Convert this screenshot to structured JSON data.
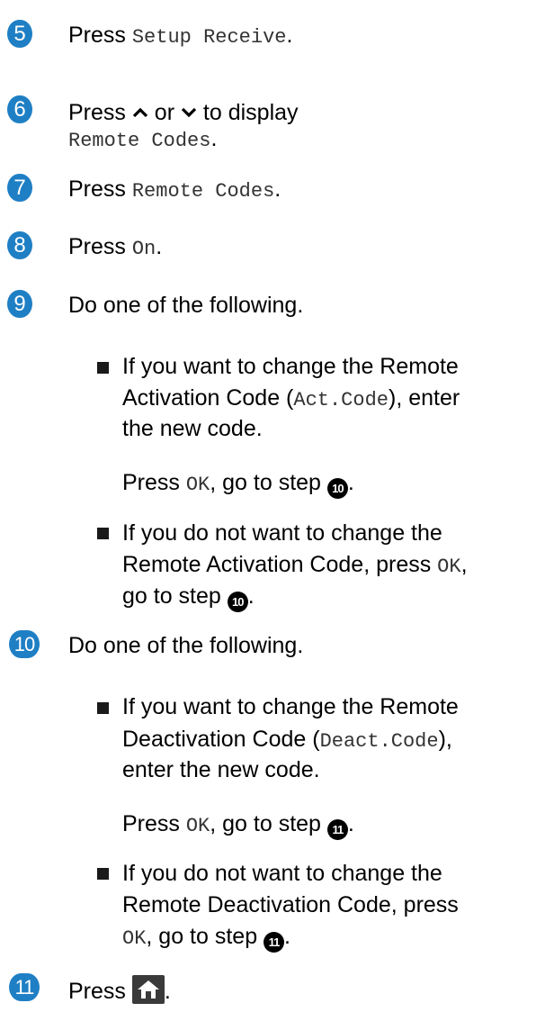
{
  "colors": {
    "step_badge": "#1f7fc4",
    "mono_text": "#333333",
    "bullet": "#1a1a1a"
  },
  "step5": {
    "num": "5",
    "text": "Press ",
    "code": "Setup Receive",
    "end": "."
  },
  "step6": {
    "num": "6",
    "p1": "Press ",
    "mid": " or ",
    "tail": " to display",
    "code": "Remote Codes",
    "end": ".",
    "icon_up": "chevron-up-icon",
    "icon_down": "chevron-down-icon"
  },
  "step7": {
    "num": "7",
    "text": "Press ",
    "code": "Remote Codes",
    "end": "."
  },
  "step8": {
    "num": "8",
    "text": "Press ",
    "code": "On",
    "end": "."
  },
  "step9": {
    "num": "9",
    "intro": "Do one of the following.",
    "b1_l1": " If you want to change the Remote",
    "b1_l2a": "Activation Code (",
    "b1_code": "Act.Code",
    "b1_l2b": "), enter",
    "b1_l3": "the new code.",
    "b1_press": "Press ",
    "b1_ok": "OK",
    "b1_goto": ", go to step ",
    "b1_ref": "10",
    "b1_end": ".",
    "b2_l1": "If you do not want to change the",
    "b2_l2a": "Remote Activation Code, press ",
    "b2_ok": "OK",
    "b2_l2b": ",",
    "b2_l3": "go to step ",
    "b2_ref": "10",
    "b2_end": "."
  },
  "step10": {
    "num": "10",
    "intro": "Do one of the following.",
    "b1_l1": " If you want to change the Remote",
    "b1_l2a": "Deactivation Code (",
    "b1_code": "Deact.Code",
    "b1_l2b": "),",
    "b1_l3": "enter the new code.",
    "b1_press": "Press ",
    "b1_ok": "OK",
    "b1_goto": ", go to step ",
    "b1_ref": "11",
    "b1_end": ".",
    "b2_l1": "If you do not want to change the",
    "b2_l2": "Remote Deactivation Code, press",
    "b2_ok": "OK",
    "b2_goto": ", go to step ",
    "b2_ref": "11",
    "b2_end": "."
  },
  "step11": {
    "num": "11",
    "text": "Press ",
    "end": ".",
    "icon": "home-icon"
  }
}
